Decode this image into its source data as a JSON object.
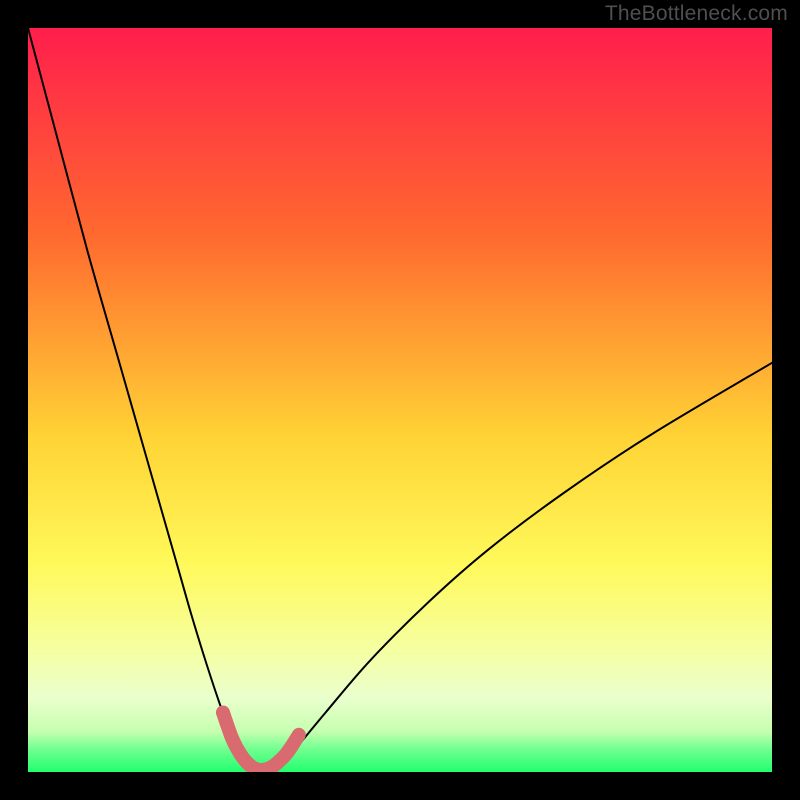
{
  "watermark": "TheBottleneck.com",
  "colors": {
    "frame_bg": "#000000",
    "gradient_top": "#ff1e4c",
    "gradient_mid_upper": "#ff8a2a",
    "gradient_mid": "#ffe438",
    "gradient_lower": "#f7ff7a",
    "gradient_pale": "#f3ffc6",
    "gradient_bottom": "#21ff6e",
    "curve_stroke": "#000000",
    "thick_accent": "#d96a6f"
  },
  "chart_data": {
    "type": "line",
    "title": "",
    "xlabel": "",
    "ylabel": "",
    "xlim": [
      0,
      100
    ],
    "ylim": [
      0,
      100
    ],
    "series": [
      {
        "name": "bottleneck-curve",
        "x": [
          0,
          4,
          8,
          12,
          16,
          20,
          22,
          24,
          26,
          27.5,
          29,
          30,
          31,
          32,
          33,
          34,
          36,
          40,
          46,
          54,
          62,
          72,
          84,
          100
        ],
        "y": [
          100,
          85,
          70,
          56,
          42,
          28,
          21,
          14.5,
          8.5,
          4.5,
          1.8,
          0.6,
          0.3,
          0.3,
          0.6,
          1.2,
          3.2,
          8.0,
          15.0,
          23.0,
          30.0,
          37.5,
          45.5,
          55.0
        ]
      },
      {
        "name": "accent-bottom-segment",
        "x": [
          26.2,
          27.4,
          28.2,
          28.9,
          29.6,
          30.3,
          31.0,
          31.7,
          32.4,
          33.1,
          33.8,
          34.6,
          35.4,
          36.4
        ],
        "y": [
          8.0,
          4.6,
          3.0,
          1.9,
          1.1,
          0.55,
          0.3,
          0.3,
          0.5,
          0.9,
          1.5,
          2.3,
          3.4,
          5.0
        ]
      }
    ],
    "gradient_stops": [
      {
        "offset": 0.0,
        "color": "#ff1e4c"
      },
      {
        "offset": 0.28,
        "color": "#ff6a2f"
      },
      {
        "offset": 0.55,
        "color": "#ffd335"
      },
      {
        "offset": 0.72,
        "color": "#fff95a"
      },
      {
        "offset": 0.83,
        "color": "#f6ff9e"
      },
      {
        "offset": 0.9,
        "color": "#eaffcd"
      },
      {
        "offset": 0.945,
        "color": "#c7ffb0"
      },
      {
        "offset": 0.97,
        "color": "#6fff8f"
      },
      {
        "offset": 1.0,
        "color": "#21ff6e"
      }
    ]
  }
}
